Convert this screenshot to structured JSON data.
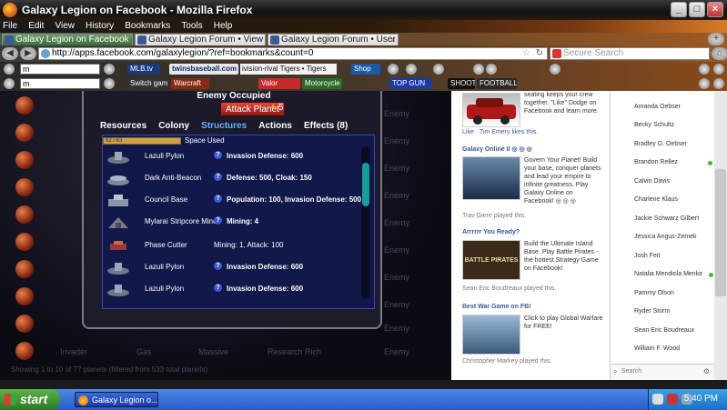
{
  "window": {
    "title": "Galaxy Legion on Facebook - Mozilla Firefox"
  },
  "menu": [
    "File",
    "Edit",
    "View",
    "History",
    "Bookmarks",
    "Tools",
    "Help"
  ],
  "tabs": [
    {
      "label": "Galaxy Legion on Facebook",
      "active": true
    },
    {
      "label": "Galaxy Legion Forum • View top...",
      "active": false
    },
    {
      "label": "Galaxy Legion Forum • User Co...",
      "active": false
    }
  ],
  "nav": {
    "url": "http://apps.facebook.com/galaxylegion/?ref=bookmarks&count=0",
    "search_placeholder": "Secure Search"
  },
  "toolbar1": {
    "input_value": "m",
    "chips": [
      "MLB.tv",
      "twinsbaseball.com",
      "ivision-rival Tigers",
      "Tigers",
      "Shop"
    ]
  },
  "toolbar2": {
    "input_value": "m",
    "chips": [
      "Switch games",
      "Warcraft",
      "Valor",
      "Motorcycle Madness",
      "TOP GUN",
      "SHOOT",
      "FOOTBALL MANIA"
    ]
  },
  "game": {
    "header": "Enemy Occupied",
    "attack_button": "Attack Planet",
    "attack_count": "5",
    "tabs": [
      "Resources",
      "Colony",
      "Structures",
      "Actions",
      "Effects (8)"
    ],
    "active_tab": "Structures",
    "space_bar_text": "62 / 63",
    "space_label": "Space Used",
    "structures": [
      {
        "name": "Lazuli Pylon",
        "effect": "Invasion Defense: 600",
        "info": true
      },
      {
        "name": "Dark Anti-Beacon",
        "effect": "Defense: 500, Cloak: 150",
        "info": true
      },
      {
        "name": "Council Base",
        "effect": "Population: 100, Invasion Defense: 500",
        "info": true
      },
      {
        "name": "Mylarai Stripcore Mine",
        "effect": "Mining: 4",
        "info": true
      },
      {
        "name": "Phase Cutter",
        "effect": "Mining: 1, Attack: 100",
        "info": false
      },
      {
        "name": "Lazuli Pylon",
        "effect": "Invasion Defense: 600",
        "info": true
      },
      {
        "name": "Lazuli Pylon",
        "effect": "Invasion Defense: 600",
        "info": true
      }
    ],
    "background_labels": [
      "Enemy",
      "Enemy",
      "Enemy",
      "Enemy",
      "Enemy",
      "Enemy",
      "Enemy",
      "Enemy",
      "Enemy",
      "Enemy",
      "Enemy",
      "Enemy"
    ],
    "bottom_row": [
      "Invader",
      "Gas",
      "Massive",
      "Research Rich",
      "Enemy"
    ],
    "showing": "Showing 1 to 10 of 77 planets (filtered from 533 total planets)"
  },
  "ads": {
    "dodge_text": "seating keeps your crew together. \"Like\" Dodge on Facebook and learn more.",
    "dodge_meta": "Like · Tim Emery likes this.",
    "galaxy_title": "Galaxy Online II ◎ ◎ ◎",
    "galaxy_text": "Govern Your Planet! Build your base, conquer planets and lead your empire to infinite greatness. Play Galaxy Online on Facebook! ◎ ◎ ◎",
    "galaxy_meta": "Trav Giere played this.",
    "pirates_title": "Arrrrrr You Ready?",
    "pirates_text": "Build the Ultimate Island Base. Play Battle Pirates - the hottest Strategy Game on Facebook!",
    "pirates_img_text": "BATTLE PIRATES",
    "pirates_meta": "Sean Eric Boudreaux played this.",
    "war_title": "Best War Game on FB!",
    "war_text": "Click to play Global Warfare for FREE!",
    "war_meta": "Christopher Markey played this."
  },
  "chat": {
    "friends": [
      {
        "name": "Amanda Oebser",
        "online": false
      },
      {
        "name": "Becky Schultz",
        "online": false
      },
      {
        "name": "Bradley O. Oebser",
        "online": false
      },
      {
        "name": "Brandon Rellez",
        "online": true
      },
      {
        "name": "Calvin Davis",
        "online": false
      },
      {
        "name": "Charlene Klaus",
        "online": false
      },
      {
        "name": "Jackie Schwarz Gilbert",
        "online": false
      },
      {
        "name": "Jessica Angus-Zemek",
        "online": false
      },
      {
        "name": "Josh Feit",
        "online": false
      },
      {
        "name": "Natalia Mendiola Menkir",
        "online": true
      },
      {
        "name": "Pammy Olson",
        "online": false
      },
      {
        "name": "Ryder Storm",
        "online": false
      },
      {
        "name": "Sean Eric Boudreaux",
        "online": false
      },
      {
        "name": "William F. Wood",
        "online": false
      }
    ],
    "search_placeholder": "Search"
  },
  "taskbar": {
    "start": "start",
    "task": "Galaxy Legion o...",
    "clock": "5:40 PM"
  }
}
